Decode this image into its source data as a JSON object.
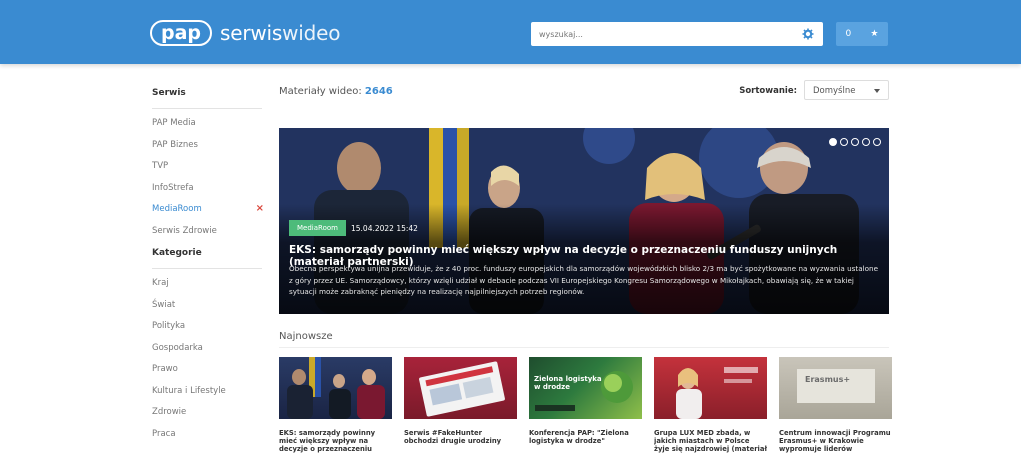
{
  "header": {
    "logo_pill": "pap",
    "logo_word_a": "serwis",
    "logo_word_b": "wideo",
    "search_placeholder": "wyszukaj...",
    "icons": [
      "gear-icon",
      "star-icon"
    ],
    "action_count": "0"
  },
  "sidebar": {
    "service_heading": "Serwis",
    "service_items": [
      {
        "label": "PAP Media",
        "active": false
      },
      {
        "label": "PAP Biznes",
        "active": false
      },
      {
        "label": "TVP",
        "active": false
      },
      {
        "label": "InfoStrefa",
        "active": false
      },
      {
        "label": "MediaRoom",
        "active": true,
        "removable": "×"
      },
      {
        "label": "Serwis Zdrowie",
        "active": false
      }
    ],
    "category_heading": "Kategorie",
    "category_items": [
      "Kraj",
      "Świat",
      "Polityka",
      "Gospodarka",
      "Prawo",
      "Kultura i Lifestyle",
      "Zdrowie",
      "Praca"
    ]
  },
  "main": {
    "count_label": "Materiały wideo:",
    "count_value": "2646",
    "sort_label": "Sortowanie:",
    "sort_value": "Domyślne"
  },
  "hero": {
    "tag": "MediaRoom",
    "date": "15.04.2022 15:42",
    "title": "EKS: samorządy powinny mieć większy wpływ na decyzje o przeznaczeniu funduszy unijnych (materiał partnerski)",
    "description": "Obecna perspektywa unijna przewiduje, że z 40 proc. funduszy europejskich dla samorządów wojewódzkich blisko 2/3 ma być spożytkowane na wyzwania ustalone z góry przez UE. Samorządowcy, którzy wzięli udział w debacie podczas VII Europejskiego Kongresu Samorządowego w Mikołajkach, obawiają się, że w takiej sytuacji może zabraknąć pieniędzy na realizację najpilniejszych potrzeb regionów.",
    "slide_count": 5,
    "active_slide": 1
  },
  "newest": {
    "heading": "Najnowsze",
    "items": [
      {
        "caption": "EKS: samorządy powinny mieć większy wpływ na decyzje o przeznaczeniu funduszy",
        "overlay": ""
      },
      {
        "caption": "Serwis #FakeHunter obchodzi drugie urodziny",
        "overlay": ""
      },
      {
        "caption": "Konferencja PAP: \"Zielona logistyka w drodze\"",
        "overlay": "Zielona logistyka\nw drodze"
      },
      {
        "caption": "Grupa LUX MED zbada, w jakich miastach w Polsce żyje się najzdrowiej (materiał",
        "overlay": ""
      },
      {
        "caption": "Centrum innowacji Programu Erasmus+ w Krakowie wypromuje liderów gospodarki",
        "overlay": "Erasmus+"
      }
    ]
  }
}
